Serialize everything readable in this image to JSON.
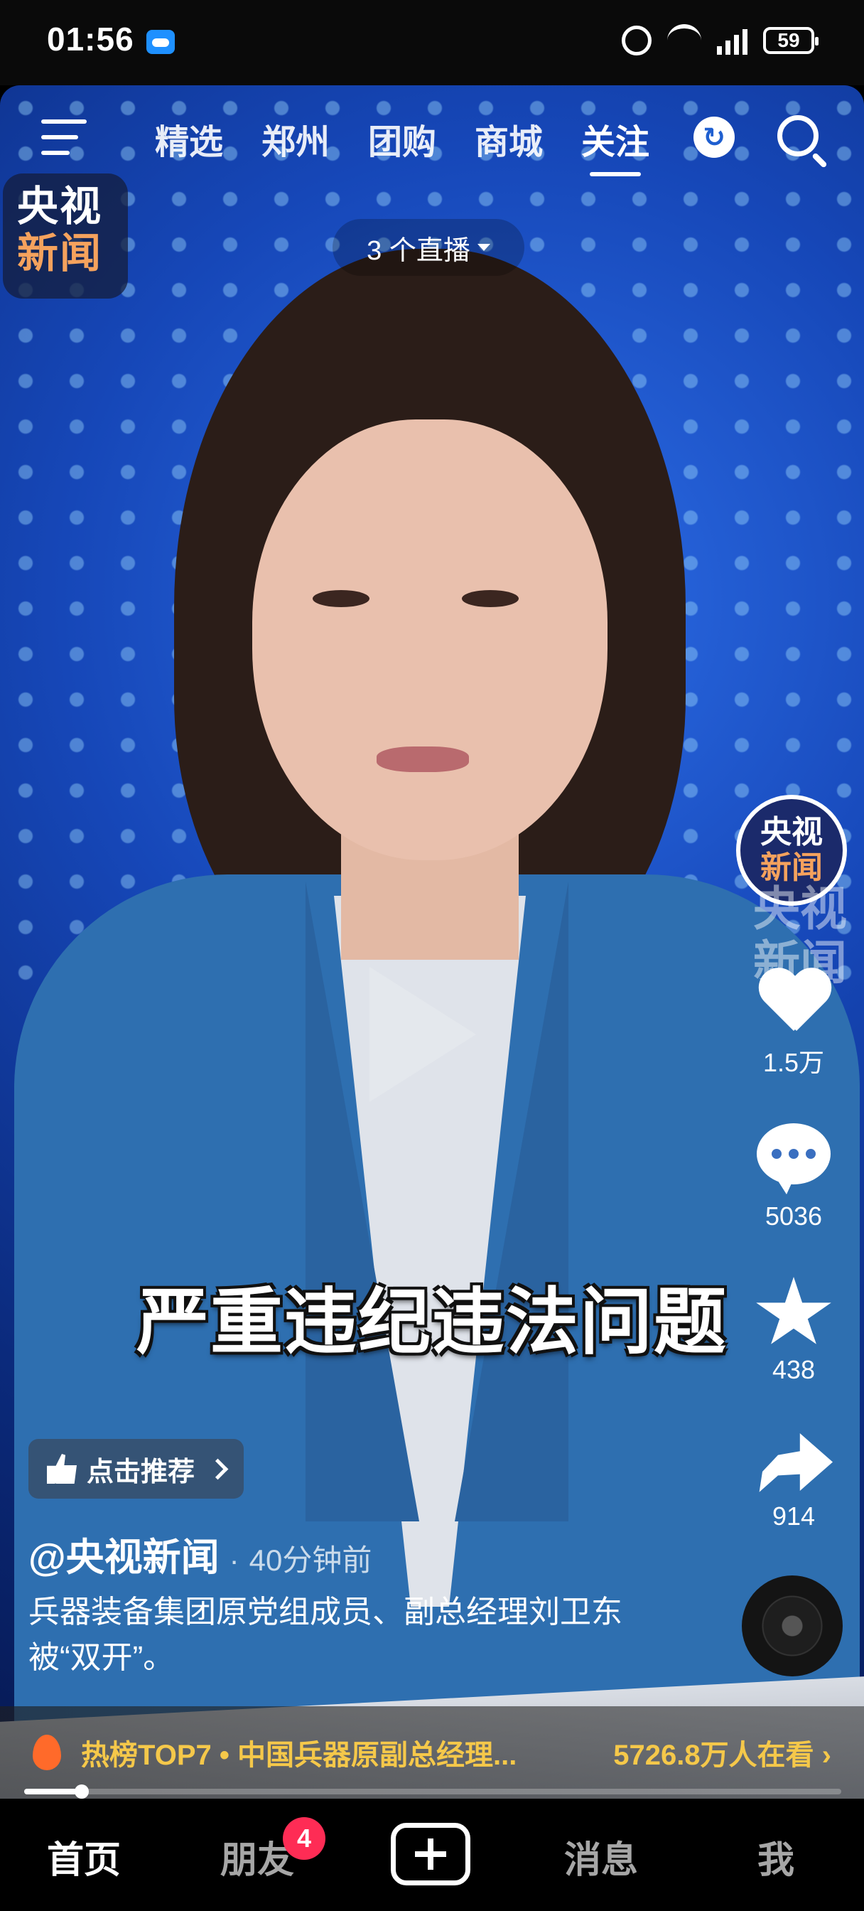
{
  "status_bar": {
    "time": "01:56",
    "battery": "59"
  },
  "top_nav": {
    "tabs": [
      "精选",
      "郑州",
      "团购",
      "商城",
      "关注"
    ],
    "active_tab": "关注"
  },
  "channel_logo": {
    "line1": "央视",
    "line2": "新闻"
  },
  "live_pill": {
    "label": "3 个直播"
  },
  "creator_avatar": {
    "line1": "央视",
    "line2": "新闻"
  },
  "watermark": {
    "line1": "央视",
    "line2": "新闻"
  },
  "actions": {
    "likes": "1.5万",
    "comments": "5036",
    "favorites": "438",
    "shares": "914"
  },
  "subtitle": "严重违纪违法问题",
  "recommend": {
    "label": "点击推荐"
  },
  "post": {
    "author": "@央视新闻",
    "time": "40分钟前",
    "description": "兵器装备集团原党组成员、副总经理刘卫东被“双开”。"
  },
  "hot_banner": {
    "text": "热榜TOP7 • 中国兵器原副总经理...",
    "viewers": "5726.8万人在看 ›"
  },
  "playback": {
    "progress_fraction": 0.07
  },
  "bottom_tabs": {
    "home": "首页",
    "friends": "朋友",
    "friends_badge": "4",
    "messages": "消息",
    "me": "我"
  },
  "colors": {
    "accent_badge": "#fe2c55",
    "hot_text": "#f5c84a",
    "logo_orange": "#f5a25d"
  }
}
